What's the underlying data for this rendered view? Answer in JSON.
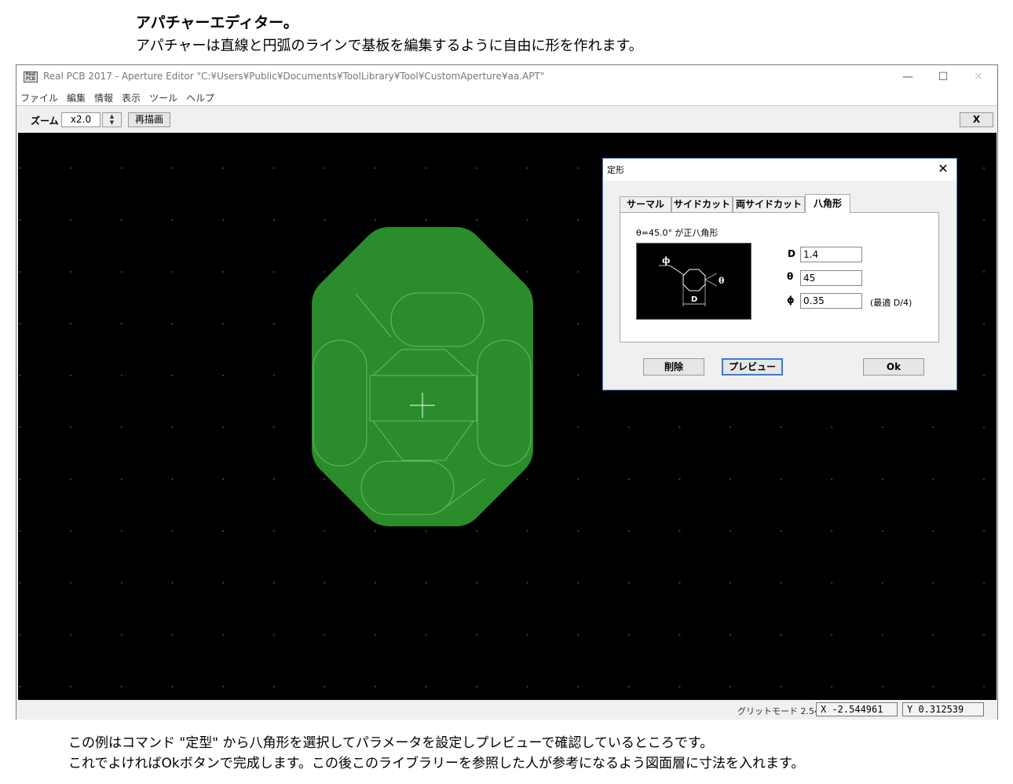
{
  "heading": "アパチャーエディター。",
  "subheading": "アパチャーは直線と円弧のラインで基板を編集するように自由に形を作れます。",
  "window": {
    "icon_text": "Real PCB",
    "title": "Real PCB 2017 - Aperture Editor \"C:¥Users¥Public¥Documents¥ToolLibrary¥Tool¥CustomAperture¥aa.APT\"",
    "minimize": "—",
    "maximize": "☐",
    "close": "✕"
  },
  "menu": [
    "ファイル",
    "編集",
    "情報",
    "表示",
    "ツール",
    "ヘルプ"
  ],
  "toolbar": {
    "zoom_label": "ズーム",
    "zoom_value": "x2.0",
    "redraw_label": "再描画",
    "close_label": "X"
  },
  "status": {
    "grid_mode": "グリットモード 2.54",
    "x": "X -2.544961",
    "y": "Y 0.312539"
  },
  "colors": {
    "shape_fill": "#2a8c2a",
    "shape_line": "#5fc45f",
    "canvas": "#000000"
  },
  "dialog": {
    "title": "定形",
    "close": "✕",
    "tabs": [
      "サーマル",
      "サイドカット",
      "両サイドカット",
      "八角形"
    ],
    "active_tab": "八角形",
    "hint": "θ=45.0° が正八角形",
    "diagram_labels": {
      "phi": "ϕ",
      "theta": "θ",
      "d": "D"
    },
    "fields": {
      "d_label": "D",
      "d_value": "1.4",
      "theta_label": "θ",
      "theta_value": "45",
      "phi_label": "ϕ",
      "phi_value": "0.35",
      "phi_note": "(最適 D/4)"
    },
    "buttons": {
      "delete": "削除",
      "preview": "プレビュー",
      "ok": "Ok"
    }
  },
  "caption": {
    "line1": "この例はコマンド \"定型\" から八角形を選択してパラメータを設定しプレビューで確認しているところです。",
    "line2": "これでよければOkボタンで完成します。この後このライブラリーを参照した人が参考になるよう図面層に寸法を入れます。"
  }
}
